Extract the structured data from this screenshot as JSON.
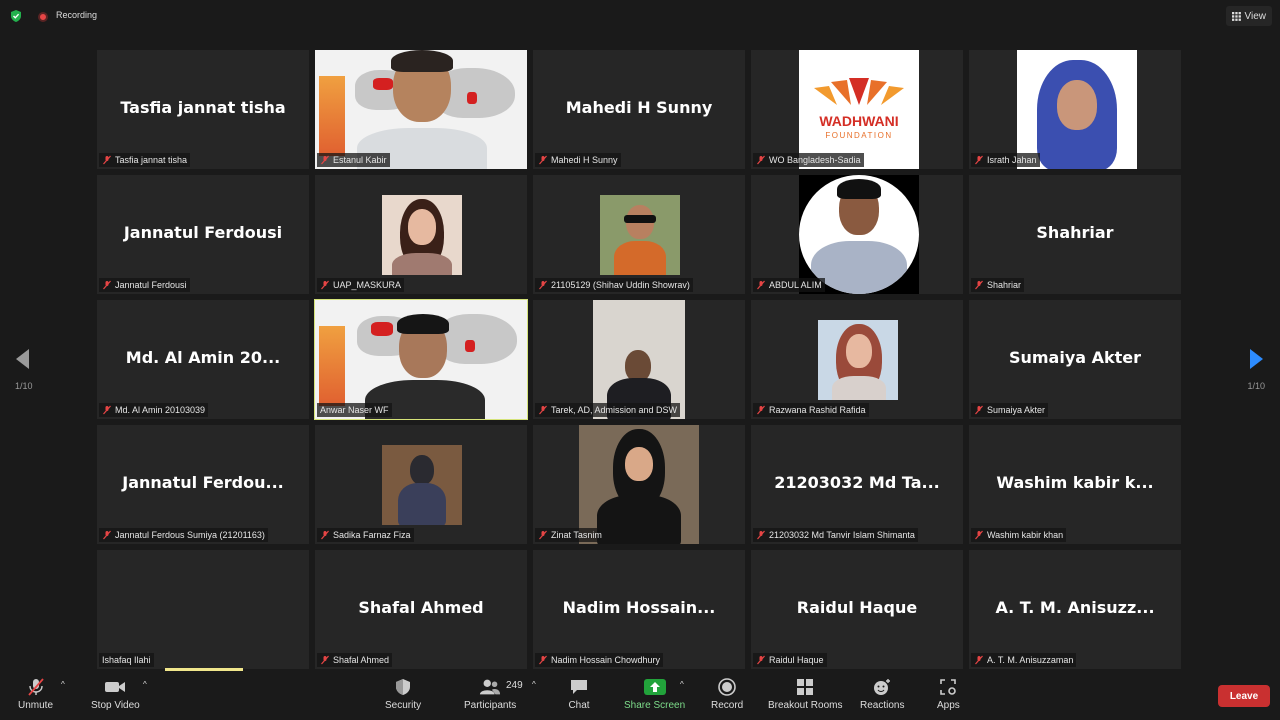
{
  "topbar": {
    "recording_label": "Recording",
    "view_label": "View"
  },
  "colors": {
    "active_speaker": "#d5e37a",
    "leave": "#c93030",
    "share": "#22a33b",
    "nav_arrow": "#2d8cff"
  },
  "tiles": [
    {
      "big": "Tasfia jannat tisha",
      "tag": "Tasfia jannat tisha"
    },
    {
      "big": "",
      "tag": "Estanul Kabir"
    },
    {
      "big": "Mahedi H Sunny",
      "tag": "Mahedi H Sunny"
    },
    {
      "big": "",
      "tag": "WO Bangladesh-Sadia"
    },
    {
      "big": "",
      "tag": "Israth Jahan"
    },
    {
      "big": "Jannatul Ferdousi",
      "tag": "Jannatul Ferdousi"
    },
    {
      "big": "",
      "tag": "UAP_MASKURA"
    },
    {
      "big": "",
      "tag": "21105129 (Shihav Uddin Showrav)"
    },
    {
      "big": "",
      "tag": "ABDUL ALIM"
    },
    {
      "big": "Shahriar",
      "tag": "Shahriar"
    },
    {
      "big": "Md. Al Amin 20...",
      "tag": "Md. Al Amin 20103039"
    },
    {
      "big": "",
      "tag": "Anwar Naser WF"
    },
    {
      "big": "",
      "tag": "Tarek, AD, Admission and DSW"
    },
    {
      "big": "",
      "tag": "Razwana Rashid Rafida"
    },
    {
      "big": "Sumaiya Akter",
      "tag": "Sumaiya Akter"
    },
    {
      "big": "Jannatul  Ferdou...",
      "tag": "Jannatul Ferdous Sumiya (21201163)"
    },
    {
      "big": "",
      "tag": "Sadika Farnaz Fiza"
    },
    {
      "big": "",
      "tag": "Zinat Tasnim"
    },
    {
      "big": "21203032  Md  Ta...",
      "tag": "21203032 Md Tanvir Islam Shimanta"
    },
    {
      "big": "Washim  kabir  k...",
      "tag": "Washim kabir khan"
    },
    {
      "big": "",
      "tag": "Ishafaq Ilahi"
    },
    {
      "big": "Shafal Ahmed",
      "tag": "Shafal Ahmed"
    },
    {
      "big": "Nadim  Hossain...",
      "tag": "Nadim Hossain Chowdhury"
    },
    {
      "big": "Raidul Haque",
      "tag": "Raidul Haque"
    },
    {
      "big": "A.  T.  M.  Anisuzz...",
      "tag": "A. T. M. Anisuzzaman"
    }
  ],
  "wadhwani": {
    "line1": "WADHWANI",
    "line2": "FOUNDATION"
  },
  "pager": {
    "left": "1/10",
    "right": "1/10"
  },
  "toolbar": {
    "unmute": "Unmute",
    "stop_video": "Stop Video",
    "security": "Security",
    "participants": "Participants",
    "participants_count": "249",
    "chat": "Chat",
    "share_screen": "Share Screen",
    "record": "Record",
    "breakout_rooms": "Breakout Rooms",
    "reactions": "Reactions",
    "apps": "Apps",
    "leave": "Leave"
  }
}
